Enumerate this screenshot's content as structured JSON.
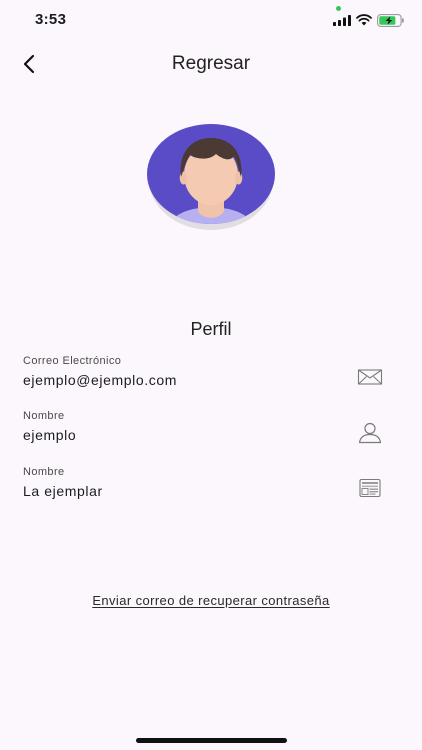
{
  "status_bar": {
    "time": "3:53",
    "battery_level": 0.8,
    "accent": "#34c759"
  },
  "header": {
    "title": "Regresar",
    "back_icon": "chevron-left-icon"
  },
  "avatar": {
    "icon": "user-avatar-icon",
    "bg_color": "#5a4bc6"
  },
  "profile": {
    "title": "Perfil",
    "fields": [
      {
        "label": "Correo Electrónico",
        "value": "ejemplo@ejemplo.com",
        "icon": "envelope-icon"
      },
      {
        "label": "Nombre",
        "value": "ejemplo",
        "icon": "person-icon"
      },
      {
        "label": "Nombre",
        "value": "La ejemplar",
        "icon": "id-card-icon"
      }
    ]
  },
  "actions": {
    "recover_password": "Enviar correo de recuperar contraseña"
  }
}
